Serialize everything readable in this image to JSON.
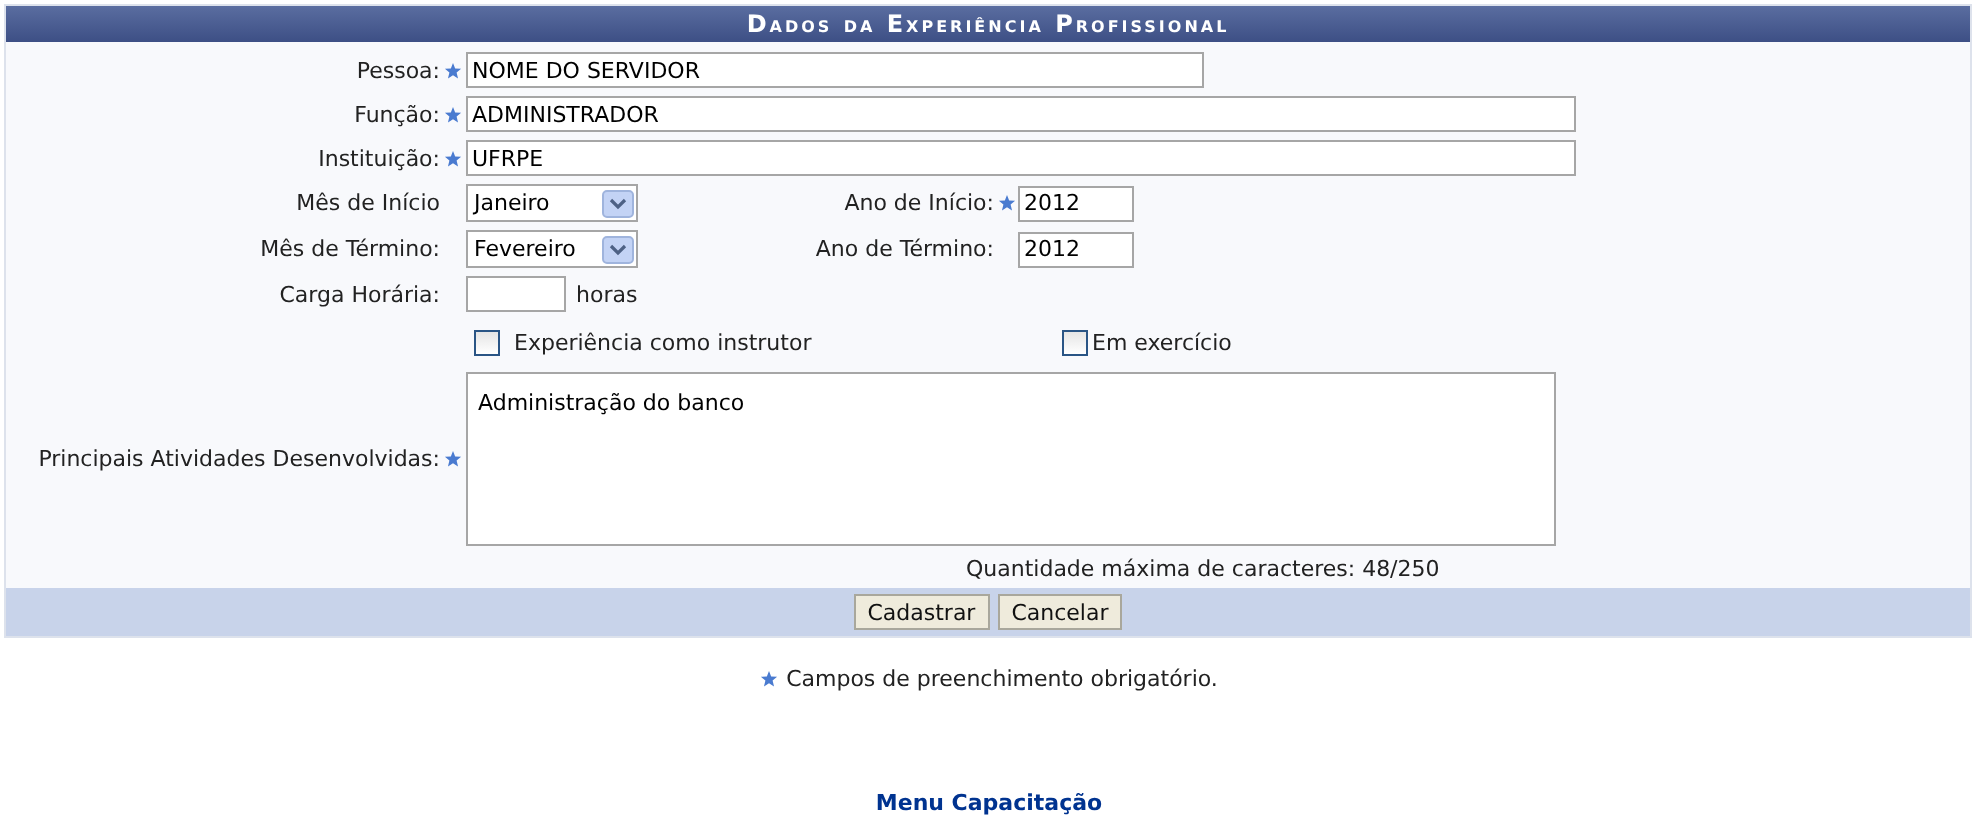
{
  "title": "Dados da Experiência Profissional",
  "person": {
    "label": "Pessoa:",
    "required": true,
    "value": "NOME DO SERVIDOR"
  },
  "role": {
    "label": "Função:",
    "required": true,
    "value": "ADMINISTRADOR"
  },
  "institution": {
    "label": "Instituição:",
    "required": true,
    "value": "UFRPE"
  },
  "start_month": {
    "label": "Mês de Início",
    "required": false,
    "value": "Janeiro"
  },
  "start_year": {
    "label": "Ano de Início:",
    "required": true,
    "value": "2012"
  },
  "end_month": {
    "label": "Mês de Término:",
    "required": false,
    "value": "Fevereiro"
  },
  "end_year": {
    "label": "Ano de Término:",
    "required": false,
    "value": "2012"
  },
  "workload": {
    "label": "Carga Horária:",
    "required": false,
    "unit": "horas"
  },
  "checkboxes": [
    {
      "label": "Experiência como instrutor",
      "checked": false
    },
    {
      "label": "Em exercício",
      "checked": false
    }
  ],
  "activities": {
    "label": "Principais Atividades Desenvolvidas:",
    "required": true,
    "value": "Administração do banco"
  },
  "counter": "Quantidade máxima de caracteres: 48/250",
  "buttons": [
    "Cadastrar",
    "Cancelar"
  ],
  "legend": "Campos de preenchimento obrigatório.",
  "footer_link": "Menu Capacitação"
}
